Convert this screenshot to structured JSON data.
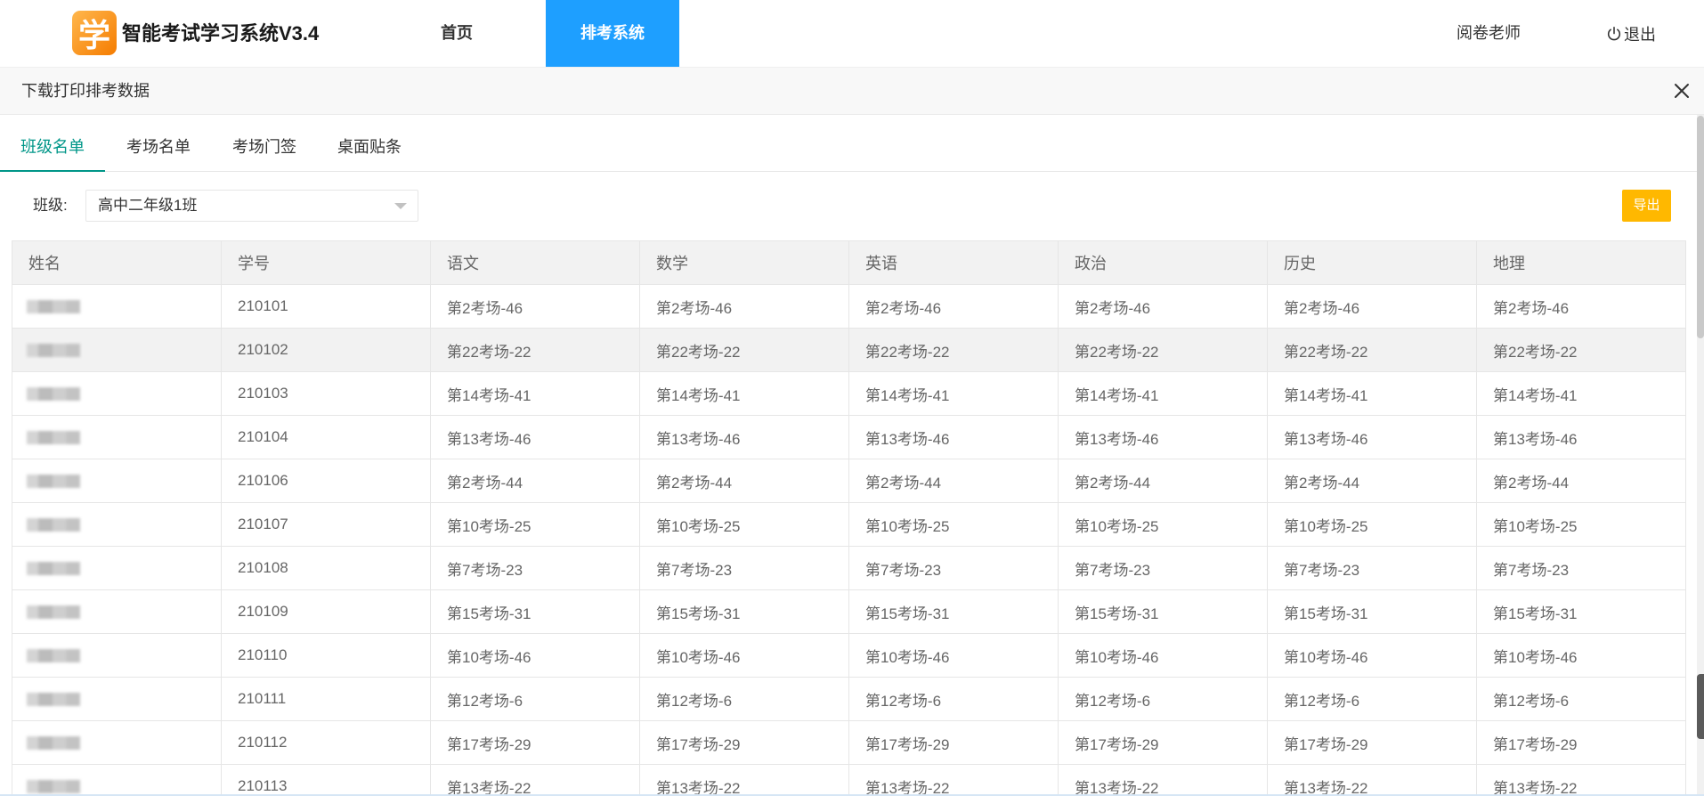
{
  "app": {
    "title": "智能考试学习系统V3.4",
    "logo_glyph": "学"
  },
  "nav": {
    "items": [
      {
        "label": "首页",
        "active": false
      },
      {
        "label": "排考系统",
        "active": true
      }
    ],
    "user": "阅卷老师",
    "logout": "退出"
  },
  "dialog": {
    "title": "下载打印排考数据"
  },
  "tabs": [
    {
      "label": "班级名单",
      "active": true
    },
    {
      "label": "考场名单",
      "active": false
    },
    {
      "label": "考场门签",
      "active": false
    },
    {
      "label": "桌面贴条",
      "active": false
    }
  ],
  "filter": {
    "class_label": "班级:",
    "class_value": "高中二年级1班",
    "export_label": "导出"
  },
  "table": {
    "columns": [
      "姓名",
      "学号",
      "语文",
      "数学",
      "英语",
      "政治",
      "历史",
      "地理"
    ],
    "highlighted_row_index": 1,
    "rows": [
      {
        "student_id": "210101",
        "rooms": [
          "第2考场-46",
          "第2考场-46",
          "第2考场-46",
          "第2考场-46",
          "第2考场-46",
          "第2考场-46"
        ]
      },
      {
        "student_id": "210102",
        "rooms": [
          "第22考场-22",
          "第22考场-22",
          "第22考场-22",
          "第22考场-22",
          "第22考场-22",
          "第22考场-22"
        ]
      },
      {
        "student_id": "210103",
        "rooms": [
          "第14考场-41",
          "第14考场-41",
          "第14考场-41",
          "第14考场-41",
          "第14考场-41",
          "第14考场-41"
        ]
      },
      {
        "student_id": "210104",
        "rooms": [
          "第13考场-46",
          "第13考场-46",
          "第13考场-46",
          "第13考场-46",
          "第13考场-46",
          "第13考场-46"
        ]
      },
      {
        "student_id": "210106",
        "rooms": [
          "第2考场-44",
          "第2考场-44",
          "第2考场-44",
          "第2考场-44",
          "第2考场-44",
          "第2考场-44"
        ]
      },
      {
        "student_id": "210107",
        "rooms": [
          "第10考场-25",
          "第10考场-25",
          "第10考场-25",
          "第10考场-25",
          "第10考场-25",
          "第10考场-25"
        ]
      },
      {
        "student_id": "210108",
        "rooms": [
          "第7考场-23",
          "第7考场-23",
          "第7考场-23",
          "第7考场-23",
          "第7考场-23",
          "第7考场-23"
        ]
      },
      {
        "student_id": "210109",
        "rooms": [
          "第15考场-31",
          "第15考场-31",
          "第15考场-31",
          "第15考场-31",
          "第15考场-31",
          "第15考场-31"
        ]
      },
      {
        "student_id": "210110",
        "rooms": [
          "第10考场-46",
          "第10考场-46",
          "第10考场-46",
          "第10考场-46",
          "第10考场-46",
          "第10考场-46"
        ]
      },
      {
        "student_id": "210111",
        "rooms": [
          "第12考场-6",
          "第12考场-6",
          "第12考场-6",
          "第12考场-6",
          "第12考场-6",
          "第12考场-6"
        ]
      },
      {
        "student_id": "210112",
        "rooms": [
          "第17考场-29",
          "第17考场-29",
          "第17考场-29",
          "第17考场-29",
          "第17考场-29",
          "第17考场-29"
        ]
      },
      {
        "student_id": "210113",
        "rooms": [
          "第13考场-22",
          "第13考场-22",
          "第13考场-22",
          "第13考场-22",
          "第13考场-22",
          "第13考场-22"
        ]
      }
    ]
  },
  "icons": {
    "logout": "power-icon",
    "close": "close-icon",
    "select": "caret-down-icon"
  },
  "colors": {
    "nav_active": "#1E9FFF",
    "tab_active": "#009688",
    "export_button": "#FFB800",
    "logo": "#F57C00"
  }
}
